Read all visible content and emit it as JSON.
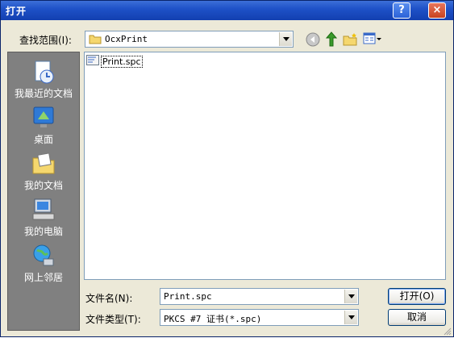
{
  "window": {
    "title": "打开",
    "help_label": "?",
    "close_label": "×"
  },
  "lookin": {
    "label": "查找范围(I):",
    "value": "OcxPrint"
  },
  "places": [
    {
      "name": "我最近的文档",
      "icon": "recent-documents-icon"
    },
    {
      "name": "桌面",
      "icon": "desktop-icon"
    },
    {
      "name": "我的文档",
      "icon": "my-documents-icon"
    },
    {
      "name": "我的电脑",
      "icon": "my-computer-icon"
    },
    {
      "name": "网上邻居",
      "icon": "network-places-icon"
    }
  ],
  "files": [
    {
      "name": "Print.spc",
      "icon": "certificate-file-icon"
    }
  ],
  "filename": {
    "label": "文件名(N):",
    "value": "Print.spc"
  },
  "filetype": {
    "label": "文件类型(T):",
    "value": "PKCS #7 证书(*.spc)"
  },
  "buttons": {
    "open": "打开(O)",
    "cancel": "取消"
  },
  "colors": {
    "title_bar": "#1f52c8",
    "dialog_bg": "#ece9d8",
    "places_bg": "#808080",
    "border": "#7f9db9"
  }
}
